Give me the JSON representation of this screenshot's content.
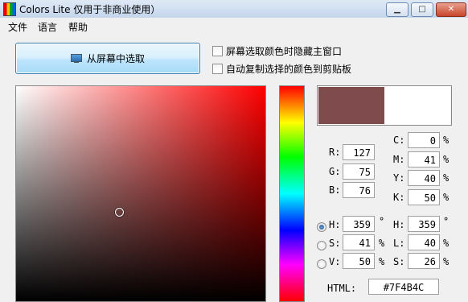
{
  "window": {
    "title": "Colors Lite 仅用于非商业使用）",
    "controls": {
      "minimize": "▁",
      "maximize": "□",
      "close": "✕"
    }
  },
  "menu": [
    "文件",
    "语言",
    "帮助"
  ],
  "pick_button": {
    "label": "从屏幕中选取",
    "icon": "monitor-icon"
  },
  "options": {
    "hide_window": "屏幕选取颜色时隐藏主窗口",
    "auto_copy": "自动复制选择的颜色到剪贴板"
  },
  "colors": {
    "current": "#7F4B4C",
    "previous": "#FFFFFF",
    "hue_max": "#FF0000"
  },
  "rgb": {
    "r_label": "R:",
    "r": "127",
    "g_label": "G:",
    "g": "75",
    "b_label": "B:",
    "b": "76"
  },
  "cmyk": {
    "c_label": "C:",
    "c": "0",
    "m_label": "M:",
    "m": "41",
    "y_label": "Y:",
    "y": "40",
    "k_label": "K:",
    "k": "50",
    "unit": "%"
  },
  "hsv": {
    "h_label": "H:",
    "h": "359",
    "h_unit": "°",
    "s_label": "S:",
    "s": "41",
    "s_unit": "%",
    "v_label": "V:",
    "v": "50",
    "v_unit": "%"
  },
  "hls": {
    "h_label": "H:",
    "h": "359",
    "h_unit": "°",
    "l_label": "L:",
    "l": "40",
    "l_unit": "%",
    "s_label": "S:",
    "s": "26",
    "s_unit": "%"
  },
  "html": {
    "label": "HTML:",
    "value": "#7F4B4C"
  }
}
